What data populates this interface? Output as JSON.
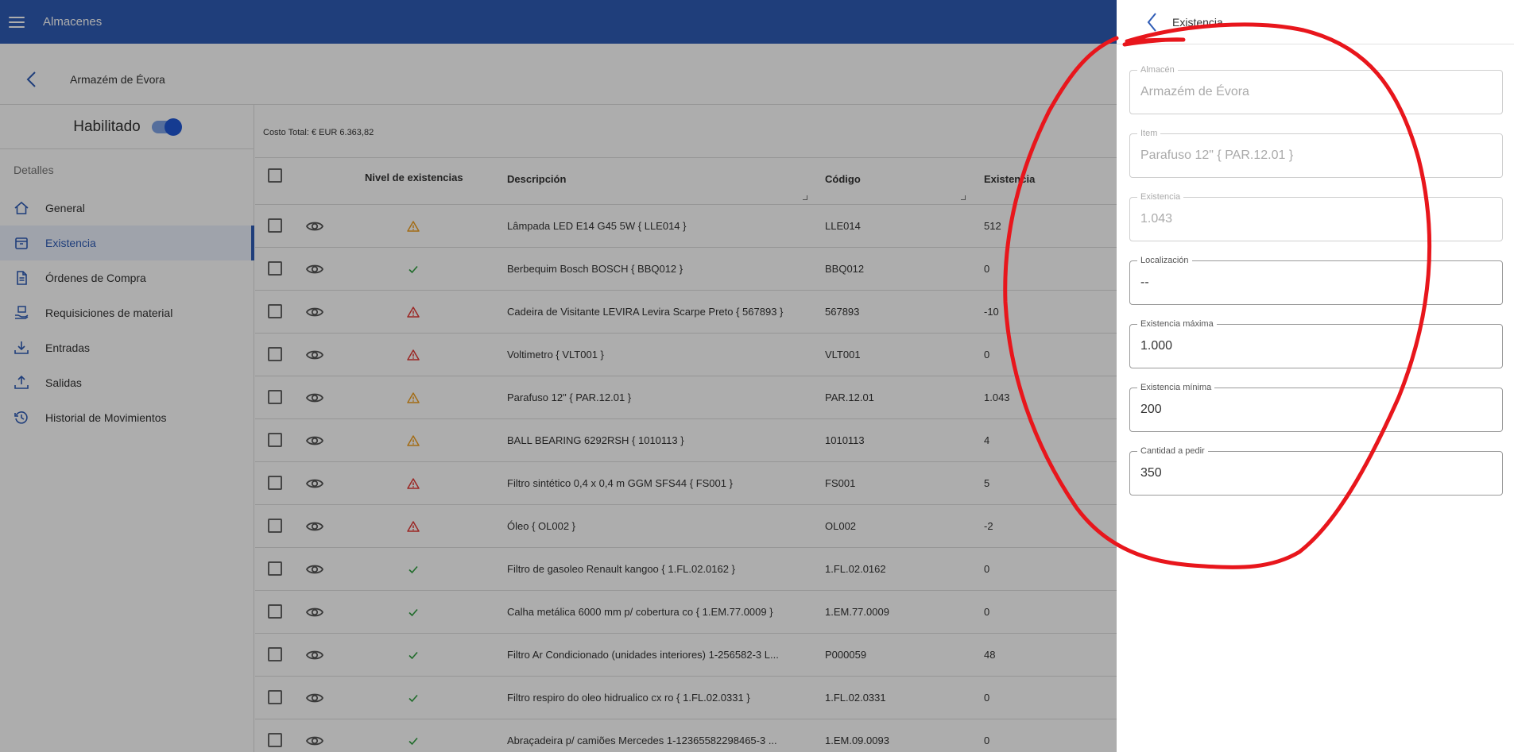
{
  "app": {
    "title": "Almacenes"
  },
  "header": {
    "title": "Armazém de Évora"
  },
  "sidenav": {
    "enabled_label": "Habilitado",
    "enabled": true,
    "section_label": "Detalles",
    "items": [
      {
        "label": "General",
        "icon": "home-icon"
      },
      {
        "label": "Existencia",
        "icon": "inventory-box-icon",
        "active": true
      },
      {
        "label": "Órdenes de Compra",
        "icon": "document-icon"
      },
      {
        "label": "Requisiciones de material",
        "icon": "hand-package-icon"
      },
      {
        "label": "Entradas",
        "icon": "download-tray-icon"
      },
      {
        "label": "Salidas",
        "icon": "upload-tray-icon"
      },
      {
        "label": "Historial de Movimientos",
        "icon": "history-icon"
      }
    ]
  },
  "table": {
    "total_cost": "Costo Total: € EUR 6.363,82",
    "columns": {
      "level": "Nivel de existencias",
      "description": "Descripción",
      "code": "Código",
      "stock": "Existencia"
    },
    "rows": [
      {
        "level": "warning",
        "description": "Lâmpada LED E14 G45 5W { LLE014 }",
        "code": "LLE014",
        "stock": "512"
      },
      {
        "level": "ok",
        "description": "Berbequim Bosch BOSCH { BBQ012 }",
        "code": "BBQ012",
        "stock": "0"
      },
      {
        "level": "danger",
        "description": "Cadeira de Visitante LEVIRA Levira Scarpe Preto { 567893 }",
        "code": "567893",
        "stock": "-10"
      },
      {
        "level": "danger",
        "description": "Voltimetro { VLT001 }",
        "code": "VLT001",
        "stock": "0"
      },
      {
        "level": "warning",
        "description": "Parafuso 12\" { PAR.12.01 }",
        "code": "PAR.12.01",
        "stock": "1.043"
      },
      {
        "level": "warning",
        "description": "BALL BEARING 6292RSH { 1010113 }",
        "code": "1010113",
        "stock": "4"
      },
      {
        "level": "danger",
        "description": "Filtro sintético 0,4 x 0,4 m GGM SFS44 { FS001 }",
        "code": "FS001",
        "stock": "5"
      },
      {
        "level": "danger",
        "description": "Óleo { OL002 }",
        "code": "OL002",
        "stock": "-2"
      },
      {
        "level": "ok",
        "description": "Filtro de gasoleo Renault kangoo { 1.FL.02.0162 }",
        "code": "1.FL.02.0162",
        "stock": "0"
      },
      {
        "level": "ok",
        "description": "Calha metálica 6000 mm p/ cobertura co { 1.EM.77.0009 }",
        "code": "1.EM.77.0009",
        "stock": "0"
      },
      {
        "level": "ok",
        "description": "Filtro Ar Condicionado (unidades interiores) 1-256582-3 L...",
        "code": "P000059",
        "stock": "48"
      },
      {
        "level": "ok",
        "description": "Filtro respiro do oleo hidrualico cx ro { 1.FL.02.0331 }",
        "code": "1.FL.02.0331",
        "stock": "0"
      },
      {
        "level": "ok",
        "description": "Abraçadeira p/ camiões Mercedes 1-12365582298465-3 ...",
        "code": "1.EM.09.0093",
        "stock": "0"
      }
    ]
  },
  "panel": {
    "title": "Existencia",
    "fields": [
      {
        "label": "Almacén",
        "value": "Armazém de Évora",
        "disabled": true
      },
      {
        "label": "Item",
        "value": "Parafuso 12\"    { PAR.12.01 }",
        "disabled": true
      },
      {
        "label": "Existencia",
        "value": "1.043",
        "disabled": true
      },
      {
        "label": "Localización",
        "value": "--",
        "disabled": false
      },
      {
        "label": "Existencia máxima",
        "value": "1.000",
        "disabled": false
      },
      {
        "label": "Existencia mínima",
        "value": "200",
        "disabled": false
      },
      {
        "label": "Cantidad a pedir",
        "value": "350",
        "disabled": false
      }
    ]
  },
  "colors": {
    "primary": "#2f5cb6",
    "warning": "#f0a020",
    "danger": "#e53935",
    "ok": "#2e9e3e",
    "annotation": "#e8161c"
  }
}
